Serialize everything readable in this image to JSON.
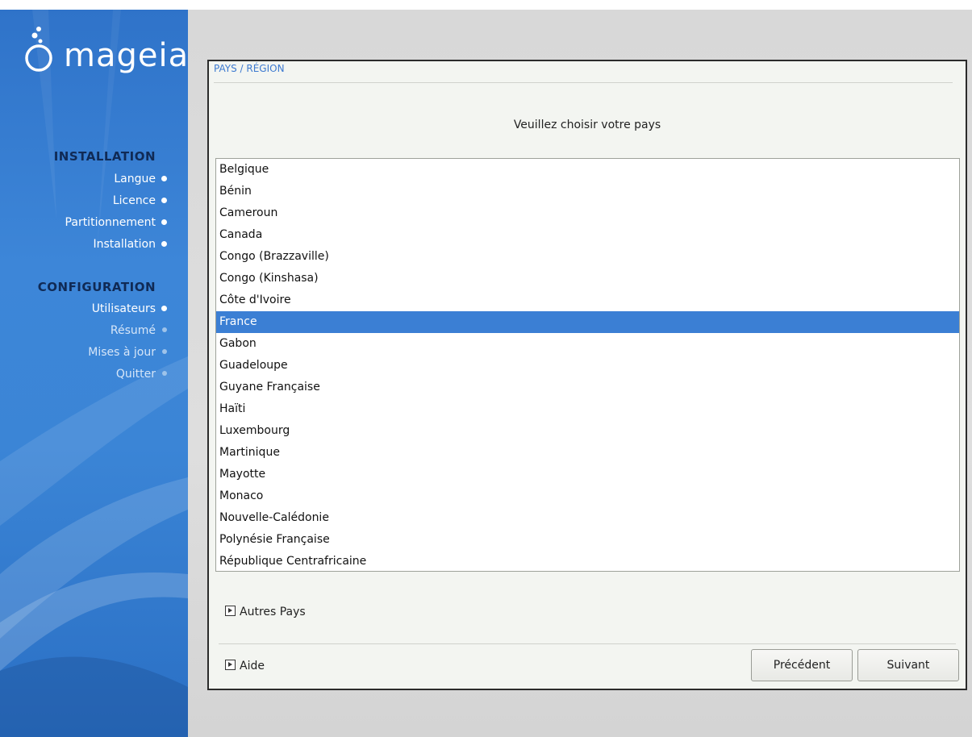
{
  "sidebar": {
    "logo_text": "mageia",
    "sections": [
      {
        "title": "INSTALLATION",
        "steps": [
          {
            "label": "Langue",
            "state": "done"
          },
          {
            "label": "Licence",
            "state": "done"
          },
          {
            "label": "Partitionnement",
            "state": "done"
          },
          {
            "label": "Installation",
            "state": "done"
          }
        ]
      },
      {
        "title": "CONFIGURATION",
        "steps": [
          {
            "label": "Utilisateurs",
            "state": "current"
          },
          {
            "label": "Résumé",
            "state": "future"
          },
          {
            "label": "Mises à jour",
            "state": "future"
          },
          {
            "label": "Quitter",
            "state": "future"
          }
        ]
      }
    ]
  },
  "dialog": {
    "title": "PAYS / RÉGION",
    "prompt": "Veuillez choisir votre pays",
    "countries": [
      "Belgique",
      "Bénin",
      "Cameroun",
      "Canada",
      "Congo (Brazzaville)",
      "Congo (Kinshasa)",
      "Côte d'Ivoire",
      "France",
      "Gabon",
      "Guadeloupe",
      "Guyane Française",
      "Haïti",
      "Luxembourg",
      "Martinique",
      "Mayotte",
      "Monaco",
      "Nouvelle-Calédonie",
      "Polynésie Française",
      "République Centrafricaine"
    ],
    "selected_country": "France",
    "other_countries_label": "Autres Pays",
    "help_label": "Aide",
    "prev_button": "Précédent",
    "next_button": "Suivant"
  },
  "colors": {
    "sidebar_blue": "#3b85d6",
    "selection_blue": "#3b7fd4",
    "title_blue": "#3d7ad0"
  }
}
